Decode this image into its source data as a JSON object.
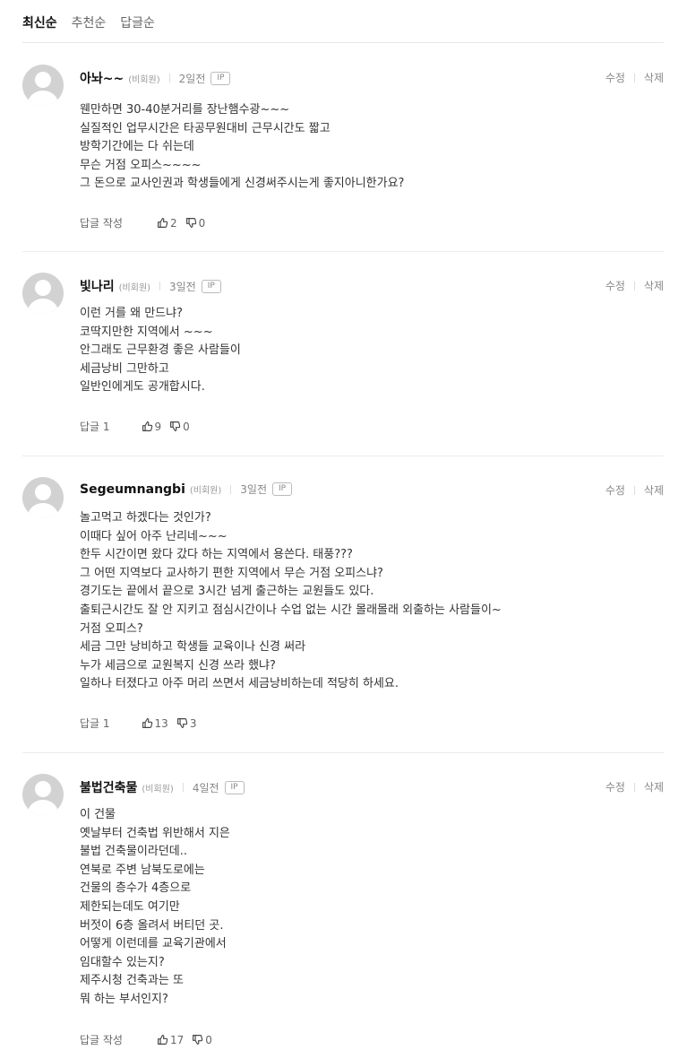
{
  "sort_tabs": [
    {
      "label": "최신순",
      "active": true
    },
    {
      "label": "추천순",
      "active": false
    },
    {
      "label": "답글순",
      "active": false
    }
  ],
  "labels": {
    "edit": "수정",
    "delete": "삭제",
    "ip": "IP"
  },
  "comments": [
    {
      "name": "아놔~~",
      "role": "(비회원)",
      "date": "2일전",
      "lines": [
        "웬만하면 30-40분거리를 장난햄수광~~~",
        "실질적인 업무시간은 타공무원대비 근무시간도 짧고",
        "방학기간에는 다 쉬는데",
        "무슨 거점 오피스~~~~",
        "그 돈으로 교사인권과 학생들에게 신경써주시는게 좋지아니한가요?"
      ],
      "reply_label": "답글 작성",
      "likes": "2",
      "dislikes": "0"
    },
    {
      "name": "빛나리",
      "role": "(비회원)",
      "date": "3일전",
      "lines": [
        "이런 거를 왜 만드냐?",
        "코딱지만한 지역에서 ~~~",
        "안그래도 근무환경 좋은 사람들이",
        "세금낭비 그만하고",
        "일반인에게도 공개합시다."
      ],
      "reply_label": "답글 1",
      "likes": "9",
      "dislikes": "0"
    },
    {
      "name": "Segeumnangbi",
      "role": "(비회원)",
      "date": "3일전",
      "lines": [
        "놀고먹고 하겠다는 것인가?",
        "이때다 싶어 아주 난리네~~~",
        "한두 시간이면 왔다 갔다 하는 지역에서 용쓴다. 태풍???",
        "그 어떤 지역보다 교사하기 편한 지역에서 무슨 거점 오피스냐?",
        "경기도는 끝에서 끝으로 3시간 넘게 출근하는 교원들도 있다.",
        "출퇴근시간도 잘 안 지키고 점심시간이나 수업 없는 시간 몰래몰래 외출하는 사람들이~",
        "거점 오피스?",
        "세금 그만 낭비하고 학생들 교육이나 신경 써라",
        "누가 세금으로 교원복지 신경 쓰라 했냐?",
        "일하나 터졌다고 아주 머리 쓰면서 세금낭비하는데 적당히 하세요."
      ],
      "reply_label": "답글 1",
      "likes": "13",
      "dislikes": "3"
    },
    {
      "name": "불법건축물",
      "role": "(비회원)",
      "date": "4일전",
      "lines": [
        "이 건물",
        "옛날부터 건축법 위반해서 지은",
        "불법 건축물이라던데..",
        "연북로 주변 남북도로에는",
        "건물의 층수가 4층으로",
        "제한되는데도 여기만",
        "버젓이 6층 올려서 버티던 곳.",
        "어떻게 이런데를 교육기관에서",
        "임대할수 있는지?",
        "제주시청 건축과는 또",
        "뭐 하는 부서인지?"
      ],
      "reply_label": "답글 작성",
      "likes": "17",
      "dislikes": "0"
    }
  ]
}
